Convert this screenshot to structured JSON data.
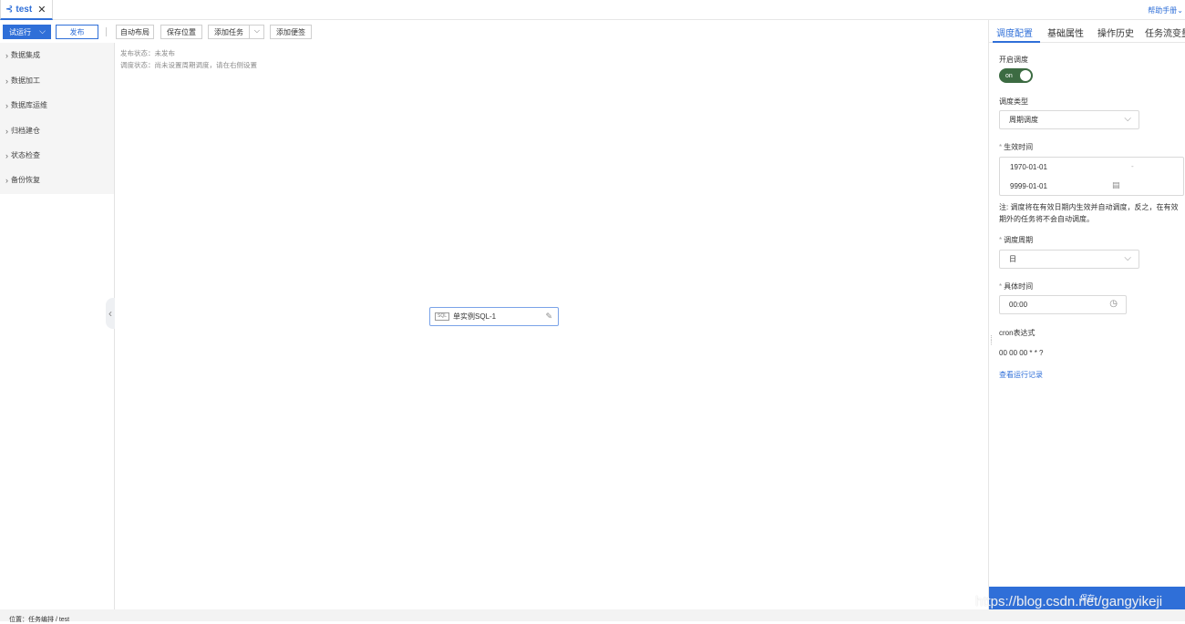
{
  "tab": {
    "title": "test",
    "help": "帮助手册"
  },
  "toolbar": {
    "trial_run": "试运行",
    "publish": "发布",
    "auto_layout": "自动布局",
    "save_position": "保存位置",
    "add_task": "添加任务",
    "add_note": "添加便签"
  },
  "sidebar": {
    "items": [
      {
        "label": "数据集成"
      },
      {
        "label": "数据加工"
      },
      {
        "label": "数据库运维"
      },
      {
        "label": "归档建仓"
      },
      {
        "label": "状态检查"
      },
      {
        "label": "备份恢复"
      }
    ]
  },
  "canvas": {
    "publish_status": "发布状态：未发布",
    "schedule_status": "调度状态：尚未设置周期调度，请在右侧设置",
    "node": {
      "icon_text": "SQL",
      "label": "单实例SQL-1"
    }
  },
  "panel": {
    "tabs": [
      "调度配置",
      "基础属性",
      "操作历史",
      "任务流变量"
    ],
    "enable_label": "开启调度",
    "toggle_text": "on",
    "type_label": "调度类型",
    "type_value": "周期调度",
    "effective_label": "生效时间",
    "date_start": "1970-01-01",
    "date_sep": "-",
    "date_end": "9999-01-01",
    "note": "注: 调度将在有效日期内生效并自动调度，反之，在有效期外的任务将不会自动调度。",
    "period_label": "调度周期",
    "period_value": "日",
    "time_label": "具体时间",
    "time_value": "00:00",
    "cron_label": "cron表达式",
    "cron_value": "00 00 00 * * ?",
    "run_log": "查看运行记录",
    "save": "保存"
  },
  "footer": {
    "breadcrumb": "位置：任务编排 / test"
  },
  "watermark": "https://blog.csdn.net/gangyikeji",
  "colors": {
    "accent": "#2f6fd8",
    "toggle_on": "#3c6b42"
  }
}
